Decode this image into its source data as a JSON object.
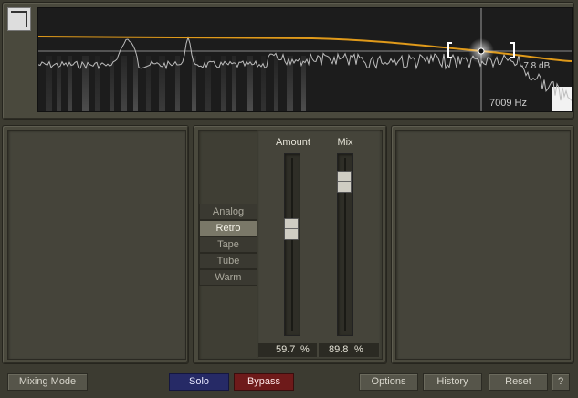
{
  "display": {
    "frequency_readout": "7009 Hz",
    "gain_readout": "-7.8 dB",
    "colors": {
      "curve": "#e09a1a",
      "spectrum": "#bdbdbd",
      "grid": "#8a8a8a"
    }
  },
  "logo": {
    "icon": "logo-icon"
  },
  "modes": {
    "items": [
      "Analog",
      "Retro",
      "Tape",
      "Tube",
      "Warm"
    ],
    "selected": "Retro"
  },
  "amount": {
    "title": "Amount",
    "value": "59.7",
    "unit": "%",
    "level": 0.597
  },
  "mix": {
    "title": "Mix",
    "value": "89.8",
    "unit": "%",
    "level": 0.898
  },
  "footer": {
    "mixing_mode": "Mixing Mode",
    "solo": "Solo",
    "bypass": "Bypass",
    "options": "Options",
    "history": "History",
    "reset": "Reset",
    "help": "?"
  }
}
